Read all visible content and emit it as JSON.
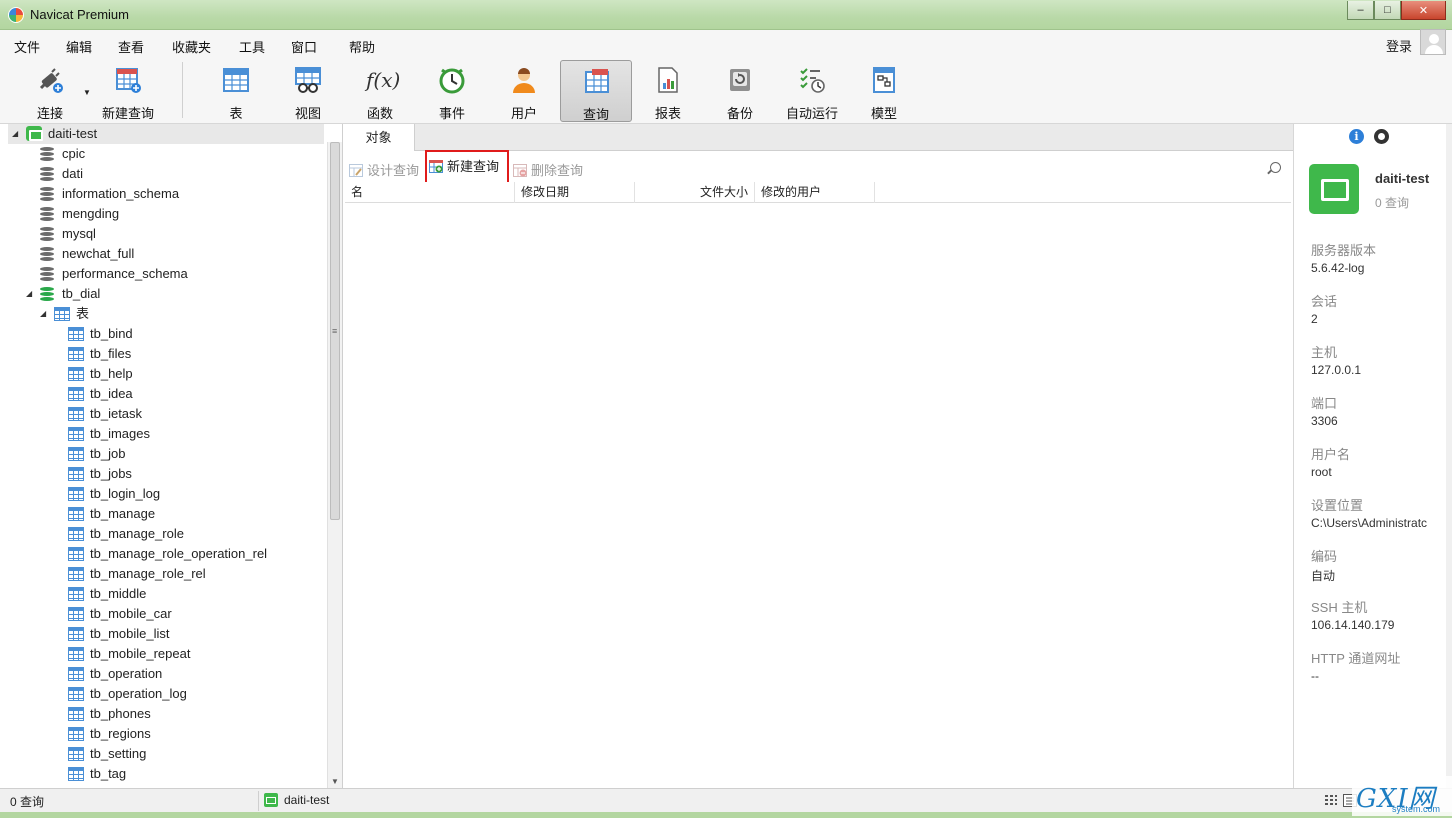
{
  "window": {
    "title": "Navicat Premium",
    "min": "–",
    "max": "□",
    "close": "✕"
  },
  "menu": {
    "items": [
      "文件",
      "编辑",
      "查看",
      "收藏夹",
      "工具",
      "窗口",
      "帮助"
    ],
    "login": "登录"
  },
  "toolbar": {
    "items": [
      {
        "label": "连接",
        "icon": "plug-icon"
      },
      {
        "label": "新建查询",
        "icon": "new-query-icon"
      },
      {
        "label": "表",
        "icon": "table-icon"
      },
      {
        "label": "视图",
        "icon": "view-icon"
      },
      {
        "label": "函数",
        "icon": "function-icon"
      },
      {
        "label": "事件",
        "icon": "clock-icon"
      },
      {
        "label": "用户",
        "icon": "user-icon"
      },
      {
        "label": "查询",
        "icon": "query-icon",
        "active": true
      },
      {
        "label": "报表",
        "icon": "report-icon"
      },
      {
        "label": "备份",
        "icon": "backup-icon"
      },
      {
        "label": "自动运行",
        "icon": "schedule-icon"
      },
      {
        "label": "模型",
        "icon": "model-icon"
      }
    ],
    "function_glyph": "f(x)"
  },
  "tree": {
    "connection": "daiti-test",
    "databases": [
      "cpic",
      "dati",
      "information_schema",
      "mengding",
      "mysql",
      "newchat_full",
      "performance_schema"
    ],
    "open_database": "tb_dial",
    "tables_node": "表",
    "tables": [
      "tb_bind",
      "tb_files",
      "tb_help",
      "tb_idea",
      "tb_ietask",
      "tb_images",
      "tb_job",
      "tb_jobs",
      "tb_login_log",
      "tb_manage",
      "tb_manage_role",
      "tb_manage_role_operation_rel",
      "tb_manage_role_rel",
      "tb_middle",
      "tb_mobile_car",
      "tb_mobile_list",
      "tb_mobile_repeat",
      "tb_operation",
      "tb_operation_log",
      "tb_phones",
      "tb_regions",
      "tb_setting",
      "tb_tag"
    ]
  },
  "center": {
    "tab": "对象",
    "actions": {
      "design": "设计查询",
      "new": "新建查询",
      "delete": "删除查询"
    },
    "columns": [
      "名",
      "修改日期",
      "文件大小",
      "修改的用户"
    ]
  },
  "info": {
    "name": "daiti-test",
    "count": "0 查询",
    "props": [
      {
        "label": "服务器版本",
        "value": "5.6.42-log"
      },
      {
        "label": "会话",
        "value": "2"
      },
      {
        "label": "主机",
        "value": "127.0.0.1"
      },
      {
        "label": "端口",
        "value": "3306"
      },
      {
        "label": "用户名",
        "value": "root"
      },
      {
        "label": "设置位置",
        "value": "C:\\Users\\Administratc"
      },
      {
        "label": "编码",
        "value": "自动"
      },
      {
        "label": "SSH 主机",
        "value": "106.14.140.179"
      },
      {
        "label": "HTTP 通道网址",
        "value": "--"
      }
    ]
  },
  "status": {
    "left": "0 查询",
    "connection": "daiti-test"
  },
  "watermark": {
    "main": "GXI网",
    "sub": "system.com"
  },
  "colors": {
    "accent": "#4a8fd6",
    "connection": "#3fb84b",
    "highlight": "#e01b1b",
    "titlebar": "#b9d9a8"
  }
}
